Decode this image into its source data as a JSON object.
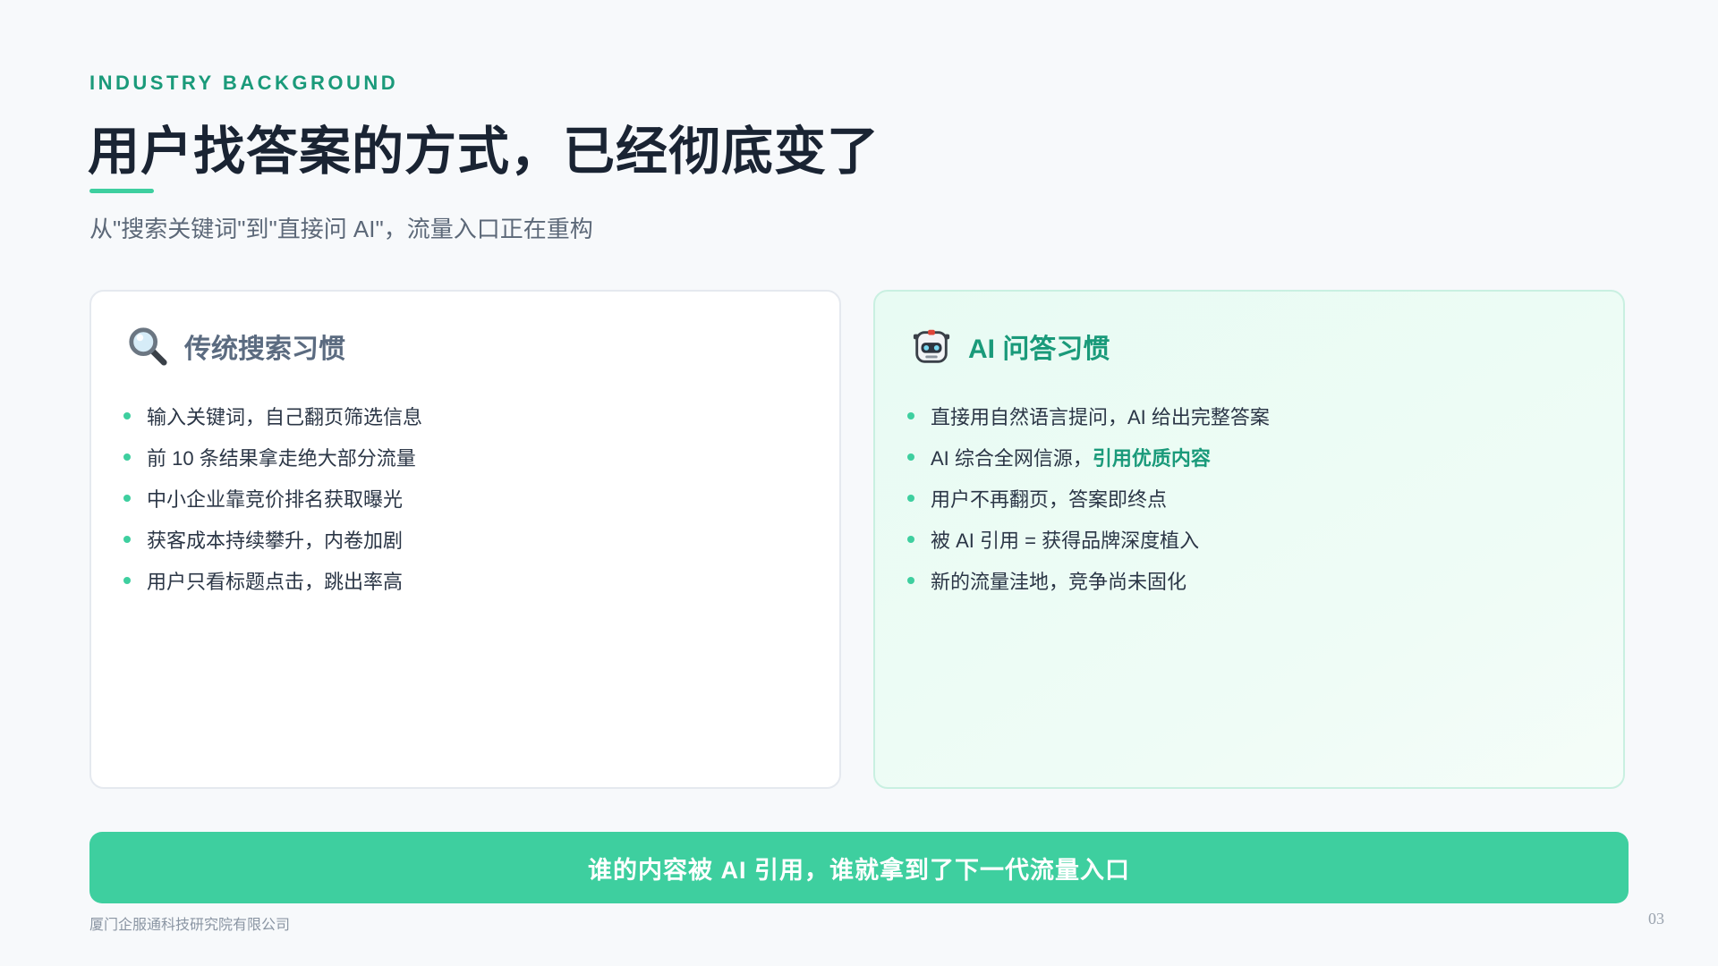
{
  "header": {
    "eyebrow": "INDUSTRY BACKGROUND",
    "title": "用户找答案的方式，已经彻底变了",
    "subtitle": "从\"搜索关键词\"到\"直接问 AI\"，流量入口正在重构"
  },
  "cards": {
    "traditional": {
      "icon": "magnifier-icon",
      "title": "传统搜索习惯",
      "items": [
        "输入关键词，自己翻页筛选信息",
        "前 10 条结果拿走绝大部分流量",
        "中小企业靠竞价排名获取曝光",
        "获客成本持续攀升，内卷加剧",
        "用户只看标题点击，跳出率高"
      ]
    },
    "ai": {
      "icon": "robot-icon",
      "title": "AI 问答习惯",
      "items": [
        "直接用自然语言提问，AI 给出完整答案",
        "AI 综合全网信源，",
        "用户不再翻页，答案即终点",
        "被 AI 引用 = 获得品牌深度植入",
        "新的流量洼地，竞争尚未固化"
      ],
      "highlight": "引用优质内容"
    }
  },
  "cta": {
    "text": "谁的内容被 AI 引用，谁就拿到了下一代流量入口"
  },
  "footer": {
    "org": "厦门企服通科技研究院有限公司",
    "page": "03"
  },
  "colors": {
    "accent": "#3ecf9f",
    "accent_dark": "#1a9a7a",
    "title": "#1a2433",
    "muted": "#5c6878"
  }
}
